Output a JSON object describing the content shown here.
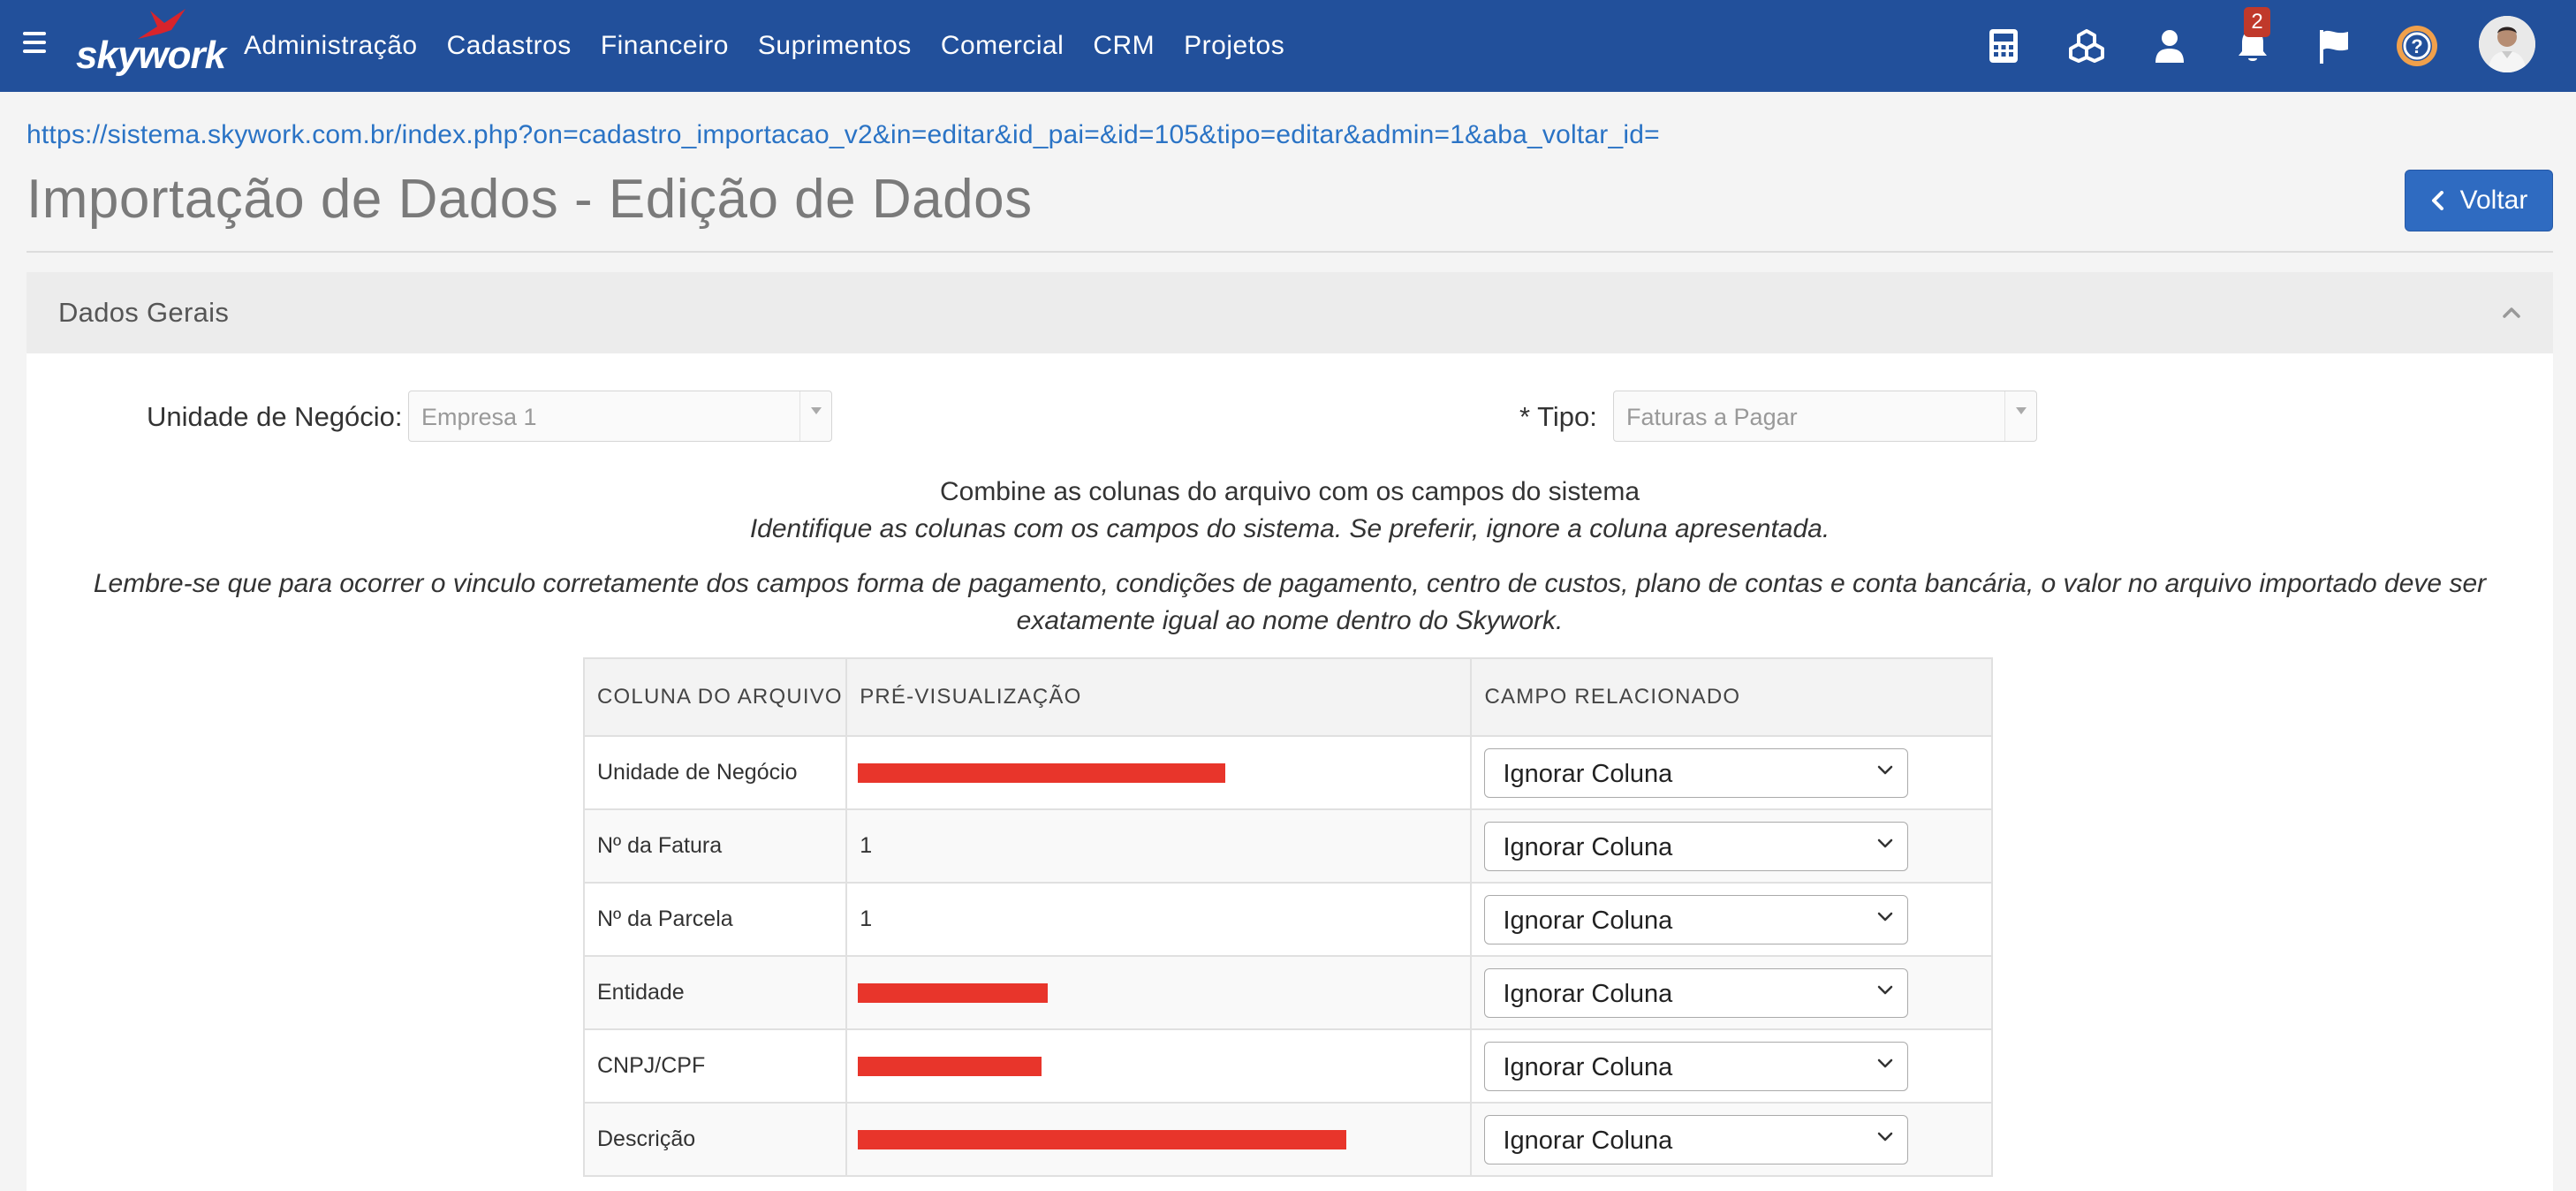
{
  "navbar": {
    "brand": "skywork",
    "menu": [
      "Administração",
      "Cadastros",
      "Financeiro",
      "Suprimentos",
      "Comercial",
      "CRM",
      "Projetos"
    ],
    "notification_count": "2",
    "icons": [
      "calculator-icon",
      "cubes-icon",
      "user-icon",
      "bell-icon",
      "flag-icon",
      "help-icon"
    ]
  },
  "page": {
    "url": "https://sistema.skywork.com.br/index.php?on=cadastro_importacao_v2&in=editar&id_pai=&id=105&tipo=editar&admin=1&aba_voltar_id=",
    "title": "Importação de Dados - Edição de Dados",
    "back_label": "Voltar"
  },
  "panel": {
    "title": "Dados Gerais",
    "business_unit_label": "Unidade de Negócio:",
    "business_unit_value": "Empresa 1",
    "type_label": "* Tipo:",
    "type_value": "Faturas a Pagar",
    "instruction_title": "Combine as colunas do arquivo com os campos do sistema",
    "instruction_subtitle": "Identifique as colunas com os campos do sistema. Se preferir, ignore a coluna apresentada.",
    "instruction_note_line1": "Lembre-se que para ocorrer o vinculo corretamente dos campos forma de pagamento, condições de pagamento, centro de custos, plano de contas e conta bancária, o valor no arquivo importado deve ser",
    "instruction_note_line2": "exatamente igual ao nome dentro do Skywork."
  },
  "table": {
    "headers": [
      "COLUNA DO ARQUIVO",
      "PRÉ-VISUALIZAÇÃO",
      "CAMPO RELACIONADO"
    ],
    "rows": [
      {
        "column": "Unidade de Negócio",
        "preview": "",
        "redacted": true,
        "redact_fraction": 0.64,
        "field": "Ignorar Coluna"
      },
      {
        "column": "Nº da Fatura",
        "preview": "1",
        "redacted": false,
        "field": "Ignorar Coluna"
      },
      {
        "column": "Nº da Parcela",
        "preview": "1",
        "redacted": false,
        "field": "Ignorar Coluna"
      },
      {
        "column": "Entidade",
        "preview": "",
        "redacted": true,
        "redact_fraction": 0.33,
        "field": "Ignorar Coluna"
      },
      {
        "column": "CNPJ/CPF",
        "preview": "",
        "redacted": true,
        "redact_fraction": 0.32,
        "field": "Ignorar Coluna"
      },
      {
        "column": "Descrição",
        "preview": "",
        "redacted": true,
        "redact_fraction": 0.85,
        "field": "Ignorar Coluna"
      }
    ]
  },
  "colors": {
    "navbar": "#22509b",
    "link": "#2a73c5",
    "button": "#2f6bc1",
    "redaction": "#e8352b",
    "badge": "#c0392b"
  }
}
